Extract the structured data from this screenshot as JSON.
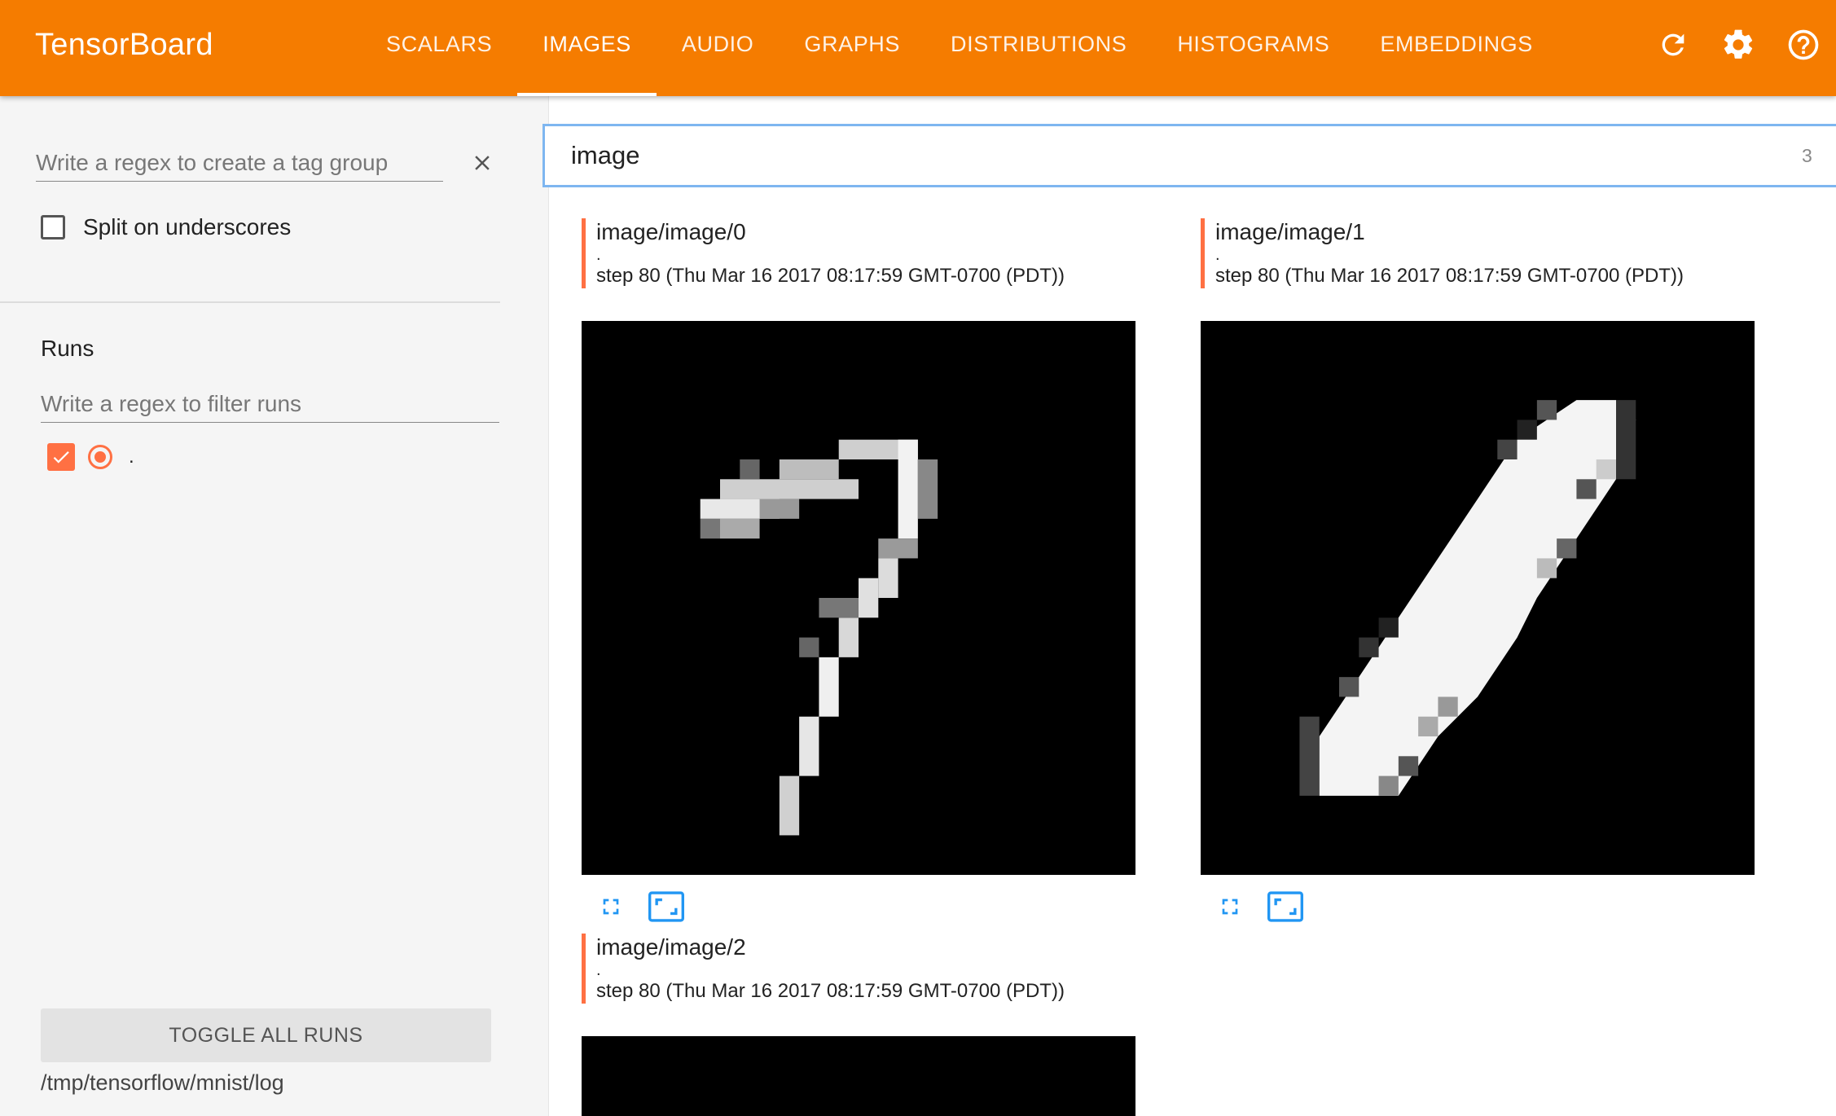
{
  "app": {
    "title": "TensorBoard"
  },
  "tabs": [
    {
      "label": "SCALARS"
    },
    {
      "label": "IMAGES"
    },
    {
      "label": "AUDIO"
    },
    {
      "label": "GRAPHS"
    },
    {
      "label": "DISTRIBUTIONS"
    },
    {
      "label": "HISTOGRAMS"
    },
    {
      "label": "EMBEDDINGS"
    }
  ],
  "active_tab": "IMAGES",
  "header_icons": [
    "reload-icon",
    "settings-icon",
    "help-icon"
  ],
  "colors": {
    "header": "#f57c00",
    "accent": "#ff7043",
    "search_border": "#7eb6f0",
    "action_icon": "#2196f3"
  },
  "sidebar": {
    "tag_group_placeholder": "Write a regex to create a tag group",
    "split_label": "Split on underscores",
    "split_checked": false,
    "runs_title": "Runs",
    "runs_filter_placeholder": "Write a regex to filter runs",
    "runs": [
      {
        "name": ".",
        "checked": true,
        "selected": true
      }
    ],
    "toggle_label": "TOGGLE ALL RUNS",
    "log_dir": "/tmp/tensorflow/mnist/log"
  },
  "search": {
    "value": "image",
    "count": "3"
  },
  "cards": [
    {
      "title": "image/image/0",
      "run": ".",
      "step": "step 80 (Thu Mar 16 2017 08:17:59 GMT-0700 (PDT))"
    },
    {
      "title": "image/image/1",
      "run": ".",
      "step": "step 80 (Thu Mar 16 2017 08:17:59 GMT-0700 (PDT))"
    },
    {
      "title": "image/image/2",
      "run": ".",
      "step": "step 80 (Thu Mar 16 2017 08:17:59 GMT-0700 (PDT))"
    }
  ]
}
